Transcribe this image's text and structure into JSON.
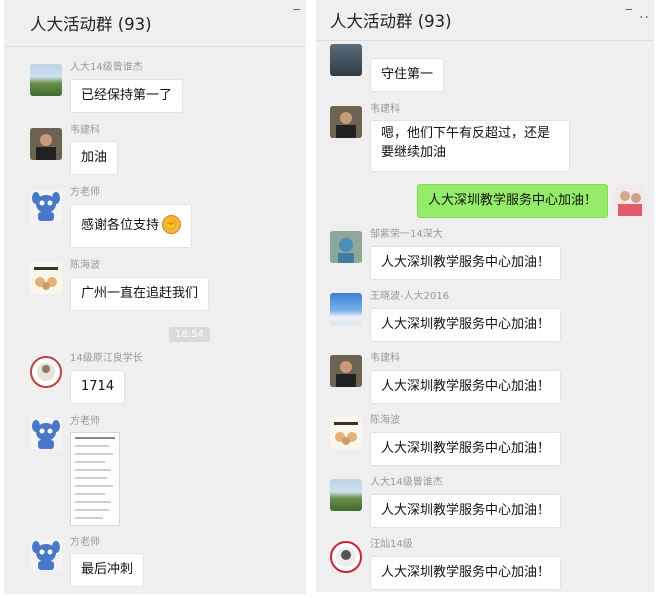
{
  "left": {
    "header": {
      "title": "人大活动群",
      "count": "(93)",
      "dash": "_"
    },
    "time": "18:54",
    "messages": [
      {
        "name": "人大14级曾谁杰",
        "text": "已经保持第一了"
      },
      {
        "name": "韦建科",
        "text": "加油"
      },
      {
        "name": "方老师",
        "text": "感谢各位支持",
        "emoji": "fist-emoji"
      },
      {
        "name": "陈海波",
        "text": "广州一直在追赶我们"
      },
      {
        "name": "14级原江良学长",
        "text": "1714"
      },
      {
        "name": "方老师",
        "image": "phone-screenshot"
      },
      {
        "name": "方老师",
        "text": "最后冲刺"
      }
    ]
  },
  "right": {
    "header": {
      "title": "人大活动群",
      "count": "(93)",
      "more": "··",
      "dash": "_"
    },
    "messages": [
      {
        "name": "",
        "text": "守住第一"
      },
      {
        "name": "韦建科",
        "text": "嗯，他们下午有反超过，还是要继续加油"
      },
      {
        "self": true,
        "text": "人大深圳教学服务中心加油！"
      },
      {
        "name": "邹紫荣一14深大",
        "text": "人大深圳教学服务中心加油！"
      },
      {
        "name": "王晓波-人大2016",
        "text": "人大深圳教学服务中心加油！"
      },
      {
        "name": "韦建科",
        "text": "人大深圳教学服务中心加油！"
      },
      {
        "name": "陈海波",
        "text": "人大深圳教学服务中心加油！"
      },
      {
        "name": "人大14级曾谁杰",
        "text": "人大深圳教学服务中心加油！"
      },
      {
        "name": "汪灿14级",
        "text": "人大深圳教学服务中心加油！"
      }
    ]
  },
  "colors": {
    "panel_bg": "#efefef",
    "bubble_self": "#95ec69",
    "bubble_other": "#ffffff",
    "name_text": "#999999"
  }
}
